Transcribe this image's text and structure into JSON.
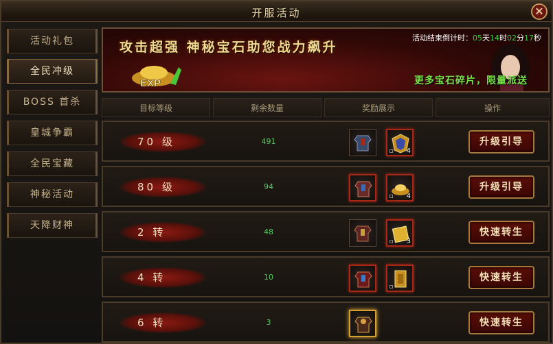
{
  "window": {
    "title": "开服活动",
    "close_label": "✕"
  },
  "sidebar": {
    "items": [
      {
        "label": "活动礼包",
        "active": false
      },
      {
        "label": "全民冲级",
        "active": true
      },
      {
        "label": "BOSS 首杀",
        "active": false
      },
      {
        "label": "皇城争霸",
        "active": false
      },
      {
        "label": "全民宝藏",
        "active": false
      },
      {
        "label": "神秘活动",
        "active": false
      },
      {
        "label": "天降财神",
        "active": false
      }
    ]
  },
  "banner": {
    "headline": "攻击超强  神秘宝石助您战力飙升",
    "countdown_prefix": "活动结束倒计时：",
    "countdown_days": "05",
    "countdown_days_unit": "天",
    "countdown_hours": "14",
    "countdown_hours_unit": "时",
    "countdown_minutes": "02",
    "countdown_minutes_unit": "分",
    "countdown_seconds": "17",
    "countdown_seconds_unit": "秒",
    "promo": "更多宝石碎片，限量派送",
    "ingot_label": "EXP"
  },
  "table": {
    "headers": [
      "目标等级",
      "剩余数量",
      "奖励展示",
      "操作"
    ],
    "rows": [
      {
        "level": "70 级",
        "remaining": "491",
        "rewards": [
          {
            "icon": "armor-icon",
            "qty": "",
            "frame": "plain"
          },
          {
            "icon": "shield-badge-icon",
            "qty": "4",
            "frame": "red"
          }
        ],
        "action": "升级引导"
      },
      {
        "level": "80 级",
        "remaining": "94",
        "rewards": [
          {
            "icon": "armor-icon",
            "qty": "",
            "frame": "red"
          },
          {
            "icon": "gold-ingot-icon",
            "qty": "4",
            "frame": "red"
          }
        ],
        "action": "升级引导"
      },
      {
        "level": "2 转",
        "remaining": "48",
        "rewards": [
          {
            "icon": "armor-icon",
            "qty": "",
            "frame": "plain"
          },
          {
            "icon": "gold-tablet-icon",
            "qty": "3",
            "frame": "red"
          }
        ],
        "action": "快速转生"
      },
      {
        "level": "4 转",
        "remaining": "10",
        "rewards": [
          {
            "icon": "armor-icon",
            "qty": "",
            "frame": "red"
          },
          {
            "icon": "gold-tablet-icon",
            "qty": "",
            "frame": "red"
          }
        ],
        "action": "快速转生"
      },
      {
        "level": "6 转",
        "remaining": "3",
        "rewards": [
          {
            "icon": "armor-icon",
            "qty": "",
            "frame": "gold"
          }
        ],
        "action": "快速转生"
      }
    ]
  },
  "colors": {
    "accent_red": "#a82818",
    "countdown_green": "#3ad43a",
    "count_green": "#58c860",
    "promo_green": "#78e048",
    "gold_border": "#a8783c"
  }
}
